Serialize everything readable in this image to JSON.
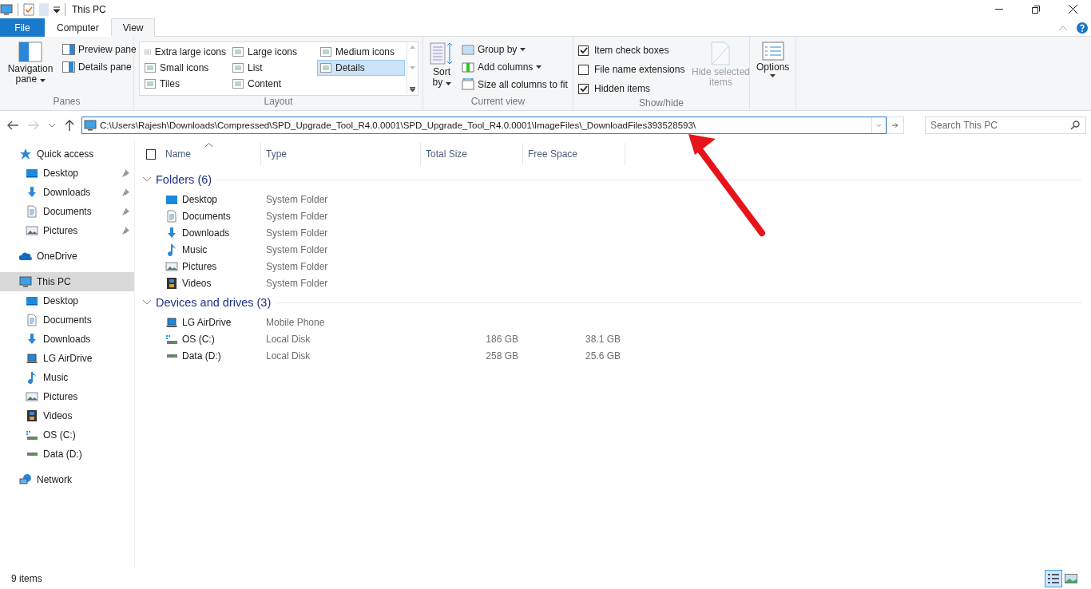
{
  "window": {
    "title": "This PC"
  },
  "tabs": [
    {
      "label": "File",
      "kind": "file",
      "selected": false
    },
    {
      "label": "Computer",
      "kind": "tab",
      "selected": false
    },
    {
      "label": "View",
      "kind": "tab",
      "selected": true
    }
  ],
  "ribbon": {
    "panes": {
      "title": "Panes",
      "navigation": "Navigation pane",
      "items": [
        {
          "label": "Preview pane",
          "kind": "preview"
        },
        {
          "label": "Details pane",
          "kind": "details"
        }
      ]
    },
    "layout": {
      "title": "Layout",
      "options": [
        {
          "label": "Extra large icons",
          "selected": false
        },
        {
          "label": "Large icons",
          "selected": false
        },
        {
          "label": "Medium icons",
          "selected": false
        },
        {
          "label": "Small icons",
          "selected": false
        },
        {
          "label": "List",
          "selected": false
        },
        {
          "label": "Details",
          "selected": true
        },
        {
          "label": "Tiles",
          "selected": false
        },
        {
          "label": "Content",
          "selected": false
        }
      ]
    },
    "current_view": {
      "title": "Current view",
      "sort": "Sort by",
      "items": [
        {
          "label": "Group by",
          "kind": "group",
          "dropdown": true
        },
        {
          "label": "Add columns",
          "kind": "add",
          "dropdown": true
        },
        {
          "label": "Size all columns to fit",
          "kind": "size",
          "dropdown": false
        }
      ]
    },
    "show_hide": {
      "title": "Show/hide",
      "checks": [
        {
          "label": "Item check boxes",
          "checked": true
        },
        {
          "label": "File name extensions",
          "checked": false
        },
        {
          "label": "Hidden items",
          "checked": true
        }
      ],
      "hide_selected": {
        "label": "Hide selected items",
        "disabled": true
      }
    },
    "options": {
      "label": "Options"
    }
  },
  "address": {
    "path": "C:\\Users\\Rajesh\\Downloads\\Compressed\\SPD_Upgrade_Tool_R4.0.0001\\SPD_Upgrade_Tool_R4.0.0001\\ImageFiles\\_DownloadFiles393528593\\"
  },
  "search": {
    "placeholder": "Search This PC"
  },
  "nav": [
    {
      "label": "Quick access",
      "kind": "star",
      "selected": false,
      "children": [
        {
          "label": "Desktop",
          "kind": "desktop",
          "pinned": true,
          "selected": false
        },
        {
          "label": "Downloads",
          "kind": "downloads",
          "pinned": true,
          "selected": false
        },
        {
          "label": "Documents",
          "kind": "documents",
          "pinned": true,
          "selected": false
        },
        {
          "label": "Pictures",
          "kind": "pictures",
          "pinned": true,
          "selected": false
        }
      ]
    },
    {
      "label": "OneDrive",
      "kind": "cloud",
      "selected": false
    },
    {
      "label": "This PC",
      "kind": "pc",
      "selected": true,
      "children": [
        {
          "label": "Desktop",
          "kind": "desktop",
          "pinned": false,
          "selected": false
        },
        {
          "label": "Documents",
          "kind": "documents",
          "pinned": false,
          "selected": false
        },
        {
          "label": "Downloads",
          "kind": "downloads",
          "pinned": false,
          "selected": false
        },
        {
          "label": "LG AirDrive",
          "kind": "laptop",
          "pinned": false,
          "selected": false
        },
        {
          "label": "Music",
          "kind": "music",
          "pinned": false,
          "selected": false
        },
        {
          "label": "Pictures",
          "kind": "pictures",
          "pinned": false,
          "selected": false
        },
        {
          "label": "Videos",
          "kind": "videos",
          "pinned": false,
          "selected": false
        },
        {
          "label": "OS (C:)",
          "kind": "osdrive",
          "pinned": false,
          "selected": false
        },
        {
          "label": "Data (D:)",
          "kind": "drive",
          "pinned": false,
          "selected": false
        }
      ]
    },
    {
      "label": "Network",
      "kind": "network",
      "selected": false
    }
  ],
  "table": {
    "select_all_checked": false,
    "columns": [
      "Name",
      "Type",
      "Total Size",
      "Free Space"
    ],
    "groups": [
      {
        "title": "Folders (6)",
        "expanded": true,
        "rows": [
          {
            "name": "Desktop",
            "kind": "desktop",
            "type": "System Folder"
          },
          {
            "name": "Documents",
            "kind": "documents",
            "type": "System Folder"
          },
          {
            "name": "Downloads",
            "kind": "downloads",
            "type": "System Folder"
          },
          {
            "name": "Music",
            "kind": "music",
            "type": "System Folder"
          },
          {
            "name": "Pictures",
            "kind": "pictures",
            "type": "System Folder"
          },
          {
            "name": "Videos",
            "kind": "videos",
            "type": "System Folder"
          }
        ]
      },
      {
        "title": "Devices and drives (3)",
        "expanded": true,
        "rows": [
          {
            "name": "LG AirDrive",
            "kind": "laptop",
            "type": "Mobile Phone"
          },
          {
            "name": "OS (C:)",
            "kind": "osdrive",
            "type": "Local Disk",
            "total": "186 GB",
            "free": "38.1 GB"
          },
          {
            "name": "Data (D:)",
            "kind": "drive",
            "type": "Local Disk",
            "total": "258 GB",
            "free": "25.6 GB"
          }
        ]
      }
    ]
  },
  "status_bar": {
    "count": "9 items",
    "views": [
      {
        "kind": "details",
        "selected": true
      },
      {
        "kind": "thumbs",
        "selected": false
      }
    ]
  }
}
